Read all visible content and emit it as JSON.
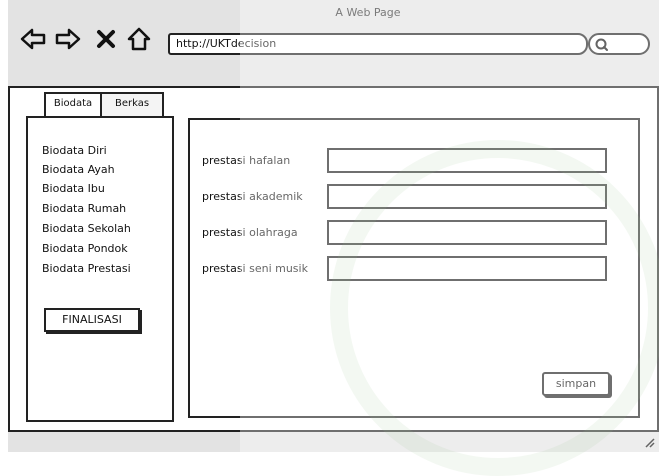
{
  "window": {
    "title": "A Web Page"
  },
  "address_bar": {
    "url": "http://UKTdecision"
  },
  "tabs": [
    {
      "label": "Biodata"
    },
    {
      "label": "Berkas"
    }
  ],
  "sidebar": {
    "items": [
      {
        "label": "Biodata Diri"
      },
      {
        "label": "Biodata Ayah"
      },
      {
        "label": "Biodata Ibu"
      },
      {
        "label": "Biodata Rumah"
      },
      {
        "label": "Biodata Sekolah"
      },
      {
        "label": "Biodata Pondok"
      },
      {
        "label": "Biodata Prestasi"
      }
    ],
    "finalize_label": "FINALISASI"
  },
  "form": {
    "fields": [
      {
        "label": "prestasi hafalan",
        "value": ""
      },
      {
        "label": "prestasi akademik",
        "value": ""
      },
      {
        "label": "prestasi olahraga",
        "value": ""
      },
      {
        "label": "prestasi seni musik",
        "value": ""
      }
    ],
    "submit_label": "simpan"
  },
  "colors": {
    "chrome_bg": "#e3e3e3",
    "border": "#222222"
  },
  "icons": [
    "back-arrow-icon",
    "forward-arrow-icon",
    "close-icon",
    "home-icon",
    "search-icon",
    "resize-grip-icon"
  ]
}
